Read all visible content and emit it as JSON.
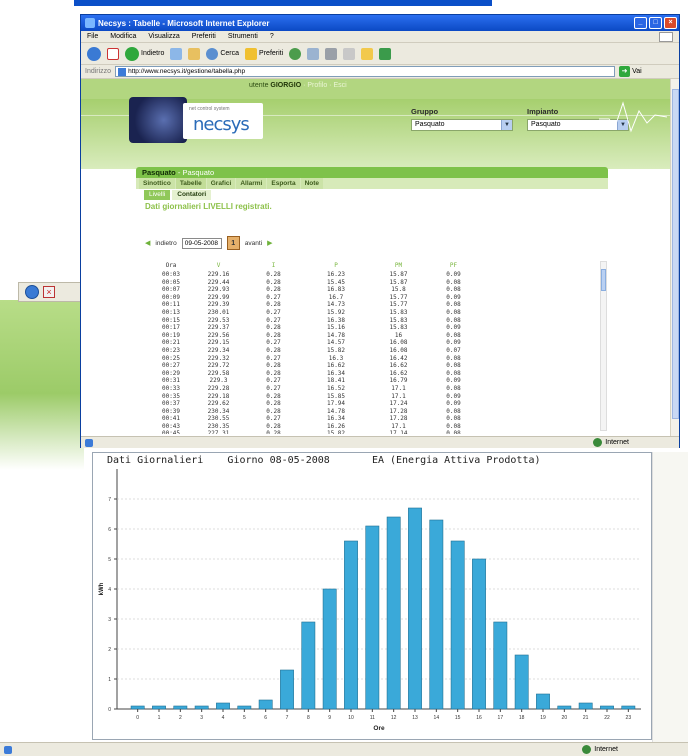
{
  "browser": {
    "title": "Necsys : Tabelle - Microsoft Internet Explorer",
    "menu": [
      "File",
      "Modifica",
      "Visualizza",
      "Preferiti",
      "Strumenti",
      "?"
    ],
    "toolbar": {
      "back_label": "Indietro",
      "search_label": "Cerca",
      "favorites_label": "Preferiti"
    },
    "address_label": "Indirizzo",
    "address_value": "http://www.necsys.it/gestione/tabella.php",
    "go_label": "Vai",
    "links_label": "",
    "status_zone": "Internet"
  },
  "page": {
    "user_prefix": "utente",
    "user_name": "GIORGIO",
    "user_links": "· Profilo · Esci",
    "logo_small": "net control system",
    "logo_text": "necsys",
    "gruppo_label": "Gruppo",
    "gruppo_value": "Pasquato",
    "impianto_label": "Impianto",
    "impianto_value": "Pasquato",
    "section_title": "Pasquato",
    "section_crumb": "- Pasquato",
    "tabs": [
      "Sinottico",
      "Tabelle",
      "Grafici",
      "Allarmi",
      "Esporta",
      "Note"
    ],
    "subtabs": [
      "Livelli",
      "Contatori"
    ],
    "heading": "Dati giornalieri LIVELLI registrati.",
    "nav_back": "indietro",
    "date_value": "09-05-2008",
    "calendar_label": "1",
    "nav_forward": "avanti",
    "columns": [
      "Ora",
      "V",
      "I",
      "P",
      "PM",
      "PF"
    ],
    "rows": [
      [
        "00:03",
        "229.16",
        "0.28",
        "16.23",
        "15.87",
        "0.09"
      ],
      [
        "00:05",
        "229.44",
        "0.28",
        "15.45",
        "15.87",
        "0.08"
      ],
      [
        "00:07",
        "229.93",
        "0.28",
        "16.83",
        "15.8",
        "0.08"
      ],
      [
        "00:09",
        "229.99",
        "0.27",
        "16.7",
        "15.77",
        "0.09"
      ],
      [
        "00:11",
        "229.39",
        "0.28",
        "14.73",
        "15.77",
        "0.08"
      ],
      [
        "00:13",
        "230.01",
        "0.27",
        "15.92",
        "15.83",
        "0.08"
      ],
      [
        "00:15",
        "229.53",
        "0.27",
        "16.38",
        "15.83",
        "0.08"
      ],
      [
        "00:17",
        "229.37",
        "0.28",
        "15.16",
        "15.83",
        "0.09"
      ],
      [
        "00:19",
        "229.56",
        "0.28",
        "14.78",
        "16",
        "0.08"
      ],
      [
        "00:21",
        "229.15",
        "0.27",
        "14.57",
        "16.08",
        "0.09"
      ],
      [
        "00:23",
        "229.34",
        "0.28",
        "15.82",
        "16.08",
        "0.07"
      ],
      [
        "00:25",
        "229.32",
        "0.27",
        "16.3",
        "16.42",
        "0.08"
      ],
      [
        "00:27",
        "229.72",
        "0.28",
        "16.62",
        "16.62",
        "0.08"
      ],
      [
        "00:29",
        "229.58",
        "0.28",
        "16.34",
        "16.62",
        "0.08"
      ],
      [
        "00:31",
        "229.3",
        "0.27",
        "18.41",
        "16.79",
        "0.09"
      ],
      [
        "00:33",
        "229.28",
        "0.27",
        "16.52",
        "17.1",
        "0.08"
      ],
      [
        "00:35",
        "229.18",
        "0.28",
        "15.85",
        "17.1",
        "0.09"
      ],
      [
        "00:37",
        "229.62",
        "0.28",
        "17.94",
        "17.24",
        "0.09"
      ],
      [
        "00:39",
        "230.34",
        "0.28",
        "14.78",
        "17.28",
        "0.08"
      ],
      [
        "00:41",
        "230.55",
        "0.27",
        "16.34",
        "17.28",
        "0.08"
      ],
      [
        "00:43",
        "230.35",
        "0.28",
        "16.26",
        "17.1",
        "0.08"
      ],
      [
        "00:45",
        "227.31",
        "0.28",
        "15.82",
        "17.14",
        "0.08"
      ],
      [
        "00:47",
        "227.36",
        "0.27",
        "17.76",
        "17.14",
        "0.08"
      ]
    ]
  },
  "chart_title": {
    "left": "Dati Giornalieri",
    "middle": "Giorno 08-05-2008",
    "right": "EA (Energia Attiva Prodotta)"
  },
  "chart_data": {
    "type": "bar",
    "title": "Dati Giornalieri   Giorno 08-05-2008   EA (Energia Attiva Prodotta)",
    "xlabel": "Ore",
    "ylabel": "kWh",
    "categories": [
      "0",
      "1",
      "2",
      "3",
      "4",
      "5",
      "6",
      "7",
      "8",
      "9",
      "10",
      "11",
      "12",
      "13",
      "14",
      "15",
      "16",
      "17",
      "18",
      "19",
      "20",
      "21",
      "22",
      "23"
    ],
    "values": [
      0.1,
      0.1,
      0.1,
      0.1,
      0.2,
      0.1,
      0.3,
      1.3,
      2.9,
      4.0,
      5.6,
      6.1,
      6.4,
      6.7,
      6.3,
      5.6,
      5.0,
      2.9,
      1.8,
      0.5,
      0.1,
      0.2,
      0.1,
      0.1
    ],
    "ylim": [
      0,
      8
    ],
    "yticks": [
      0,
      1,
      2,
      3,
      4,
      5,
      6,
      7
    ],
    "grid": true,
    "bar_color": "#3aa9d9"
  }
}
